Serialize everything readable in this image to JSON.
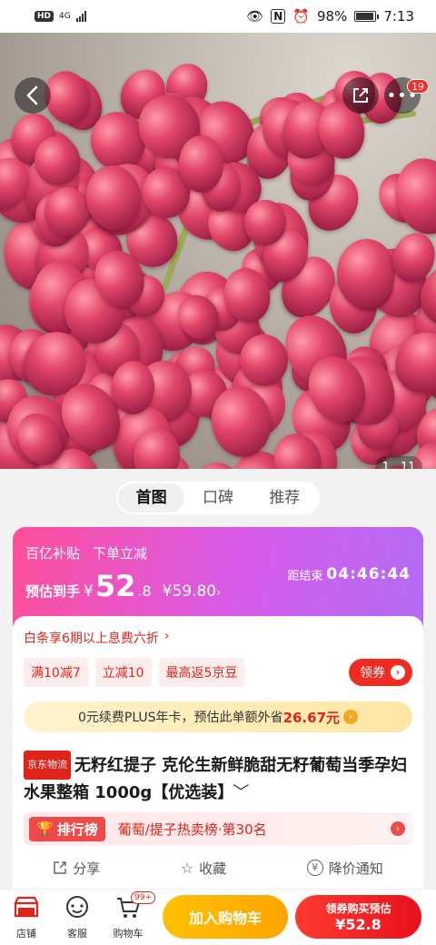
{
  "status_bar": {
    "hd": "HD",
    "network": "4G",
    "battery_percent": "98%",
    "battery_level": 0.98,
    "time": "7:13"
  },
  "hero": {
    "notification_count": "19",
    "page_current": "1",
    "page_total": "11",
    "icons": [
      "chevron-left-icon",
      "share-icon",
      "more-icon"
    ]
  },
  "tabs": [
    {
      "label": "首图",
      "active": true
    },
    {
      "label": "口碑",
      "active": false
    },
    {
      "label": "推荐",
      "active": false
    }
  ],
  "promo": {
    "tag1": "百亿补贴",
    "tag2": "下单立减",
    "est_label": "预估到手",
    "currency": "¥",
    "price_int": "52",
    "price_dec": ".8",
    "orig_price": "¥59.80",
    "countdown_label": "距结束",
    "countdown": "04:46:44"
  },
  "info": {
    "baitiao": "白条享6期以上息费六折",
    "coupons": [
      "满10减7",
      "立减10",
      "最高返5京豆"
    ],
    "get_coupon": "领券",
    "plus_text": "0元续费PLUS年卡，预估此单额外省",
    "plus_save": "26.67元",
    "jd_tag": "京东物流",
    "title": "无籽红提子 克伦生新鲜脆甜无籽葡萄当季孕妇水果整箱 1000g【优选装】",
    "rank_badge": "排行榜",
    "rank_text": "葡萄/提子热卖榜·第30名",
    "actions": {
      "share": "分享",
      "favorite": "收藏",
      "price_alert": "降价通知"
    }
  },
  "bottom": {
    "shop": "店铺",
    "service": "客服",
    "cart": "购物车",
    "cart_badge": "99+",
    "add_cart": "加入购物车",
    "buy_line1": "领券购买预估",
    "buy_line2": "¥52.8"
  },
  "colors": {
    "accent_red": "#e2231a",
    "promo_gradient_start": "#ff4f9a",
    "promo_gradient_end": "#b26cf5",
    "cart_button": "#ffb000",
    "buy_button": "#ef2b22"
  }
}
